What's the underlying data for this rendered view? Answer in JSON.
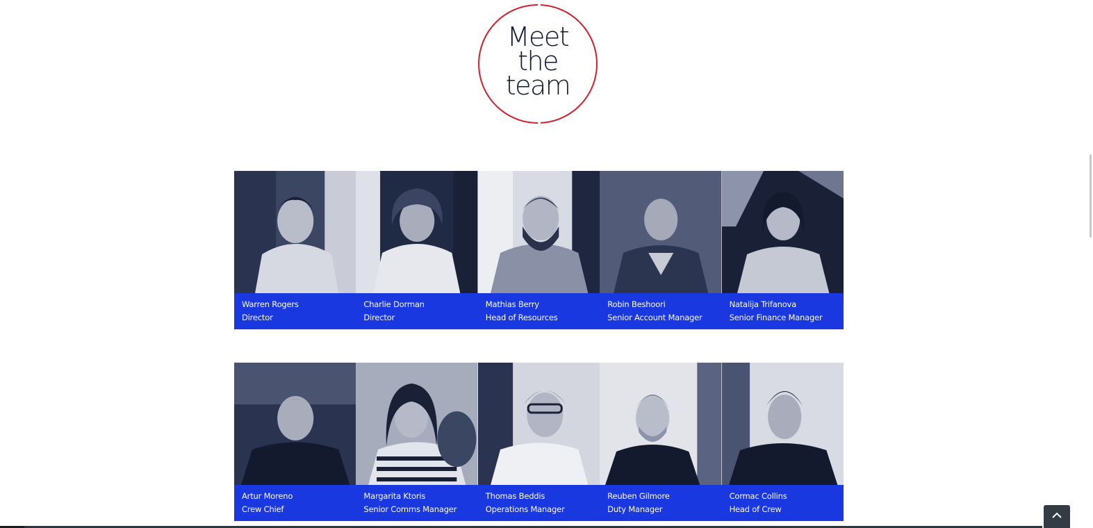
{
  "heading": {
    "line1": "Meet",
    "line2": "the",
    "line3": "team"
  },
  "colors": {
    "accent_red": "#d31f2a",
    "caption_blue": "#1a38e0",
    "heading_navy": "#0f1733"
  },
  "team": {
    "row1": [
      {
        "name": "Warren Rogers",
        "role": "Director"
      },
      {
        "name": "Charlie Dorman",
        "role": "Director"
      },
      {
        "name": "Mathias Berry",
        "role": "Head of Resources"
      },
      {
        "name": "Robin Beshoori",
        "role": "Senior Account Manager"
      },
      {
        "name": "Natalija Trifanova",
        "role": "Senior Finance Manager"
      }
    ],
    "row2": [
      {
        "name": "Artur Moreno",
        "role": "Crew Chief"
      },
      {
        "name": "Margarita Ktoris",
        "role": "Senior Comms Manager"
      },
      {
        "name": "Thomas Beddis",
        "role": "Operations Manager"
      },
      {
        "name": "Reuben Gilmore",
        "role": "Duty Manager"
      },
      {
        "name": "Cormac Collins",
        "role": "Head of Crew"
      }
    ]
  },
  "back_to_top_icon": "chevron-up-icon"
}
